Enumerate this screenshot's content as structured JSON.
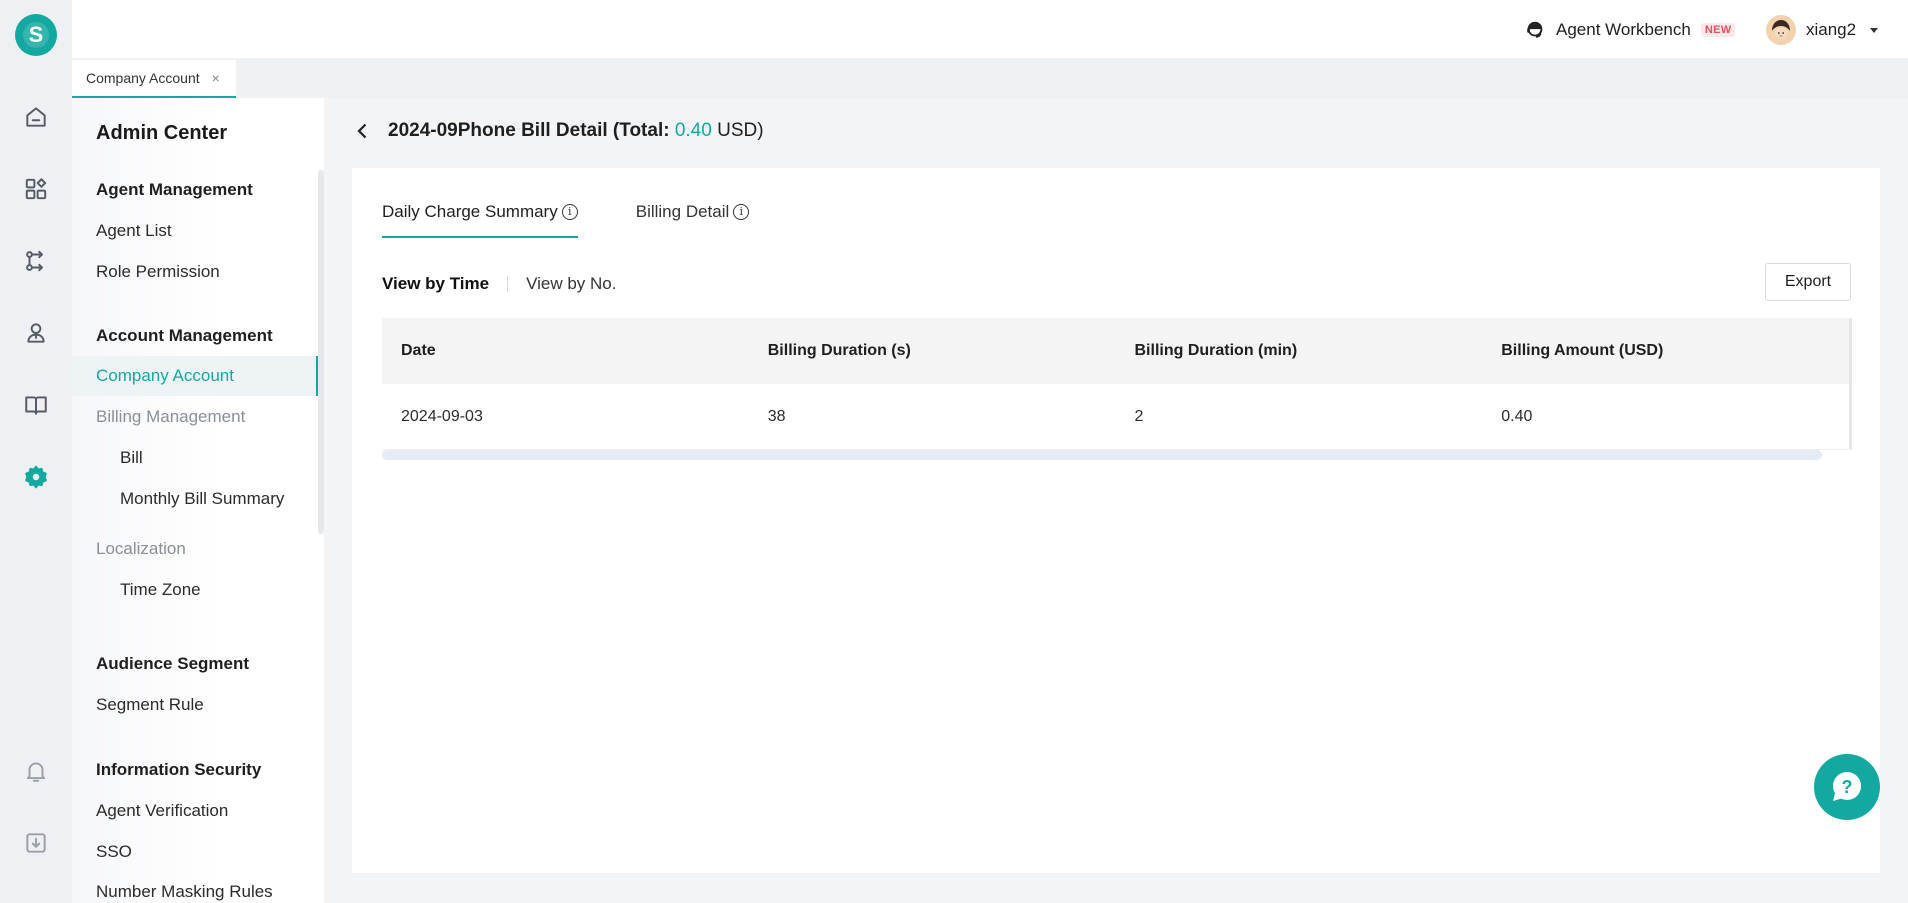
{
  "colors": {
    "accent": "#13a9a0",
    "badge": "#e8505b"
  },
  "rail": {
    "logo_letter": "S",
    "icons": [
      "home-icon",
      "apps-icon",
      "route-icon",
      "contacts-icon",
      "book-icon",
      "settings-icon",
      "bell-icon",
      "download-icon"
    ],
    "active": "settings-icon"
  },
  "header": {
    "workbench_label": "Agent Workbench",
    "workbench_badge": "NEW",
    "user_name": "xiang2"
  },
  "page_tabs": [
    {
      "label": "Company Account",
      "close": "×"
    }
  ],
  "sidebar": {
    "title": "Admin Center",
    "groups": {
      "agent": "Agent Management",
      "account": "Account Management",
      "audience": "Audience Segment",
      "security": "Information Security"
    },
    "items": {
      "agent_list": "Agent List",
      "role_permission": "Role Permission",
      "company_account": "Company Account",
      "billing_management": "Billing Management",
      "bill": "Bill",
      "monthly_bill_summary": "Monthly Bill Summary",
      "localization": "Localization",
      "time_zone": "Time Zone",
      "segment_rule": "Segment Rule",
      "agent_verification": "Agent Verification",
      "sso": "SSO",
      "number_masking_rules": "Number Masking Rules"
    }
  },
  "main": {
    "title_prefix": "2024-09Phone Bill Detail (Total: ",
    "title_total": "0.40",
    "title_suffix": " USD)",
    "tabs": [
      {
        "label": "Daily Charge Summary",
        "info": "i"
      },
      {
        "label": "Billing Detail",
        "info": "i"
      }
    ],
    "view_options": [
      "View by Time",
      "View by No."
    ],
    "export_label": "Export",
    "table": {
      "headers": [
        "Date",
        "Billing Duration (s)",
        "Billing Duration (min)",
        "Billing Amount (USD)"
      ],
      "rows": [
        [
          "2024-09-03",
          "38",
          "2",
          "0.40"
        ]
      ]
    }
  }
}
